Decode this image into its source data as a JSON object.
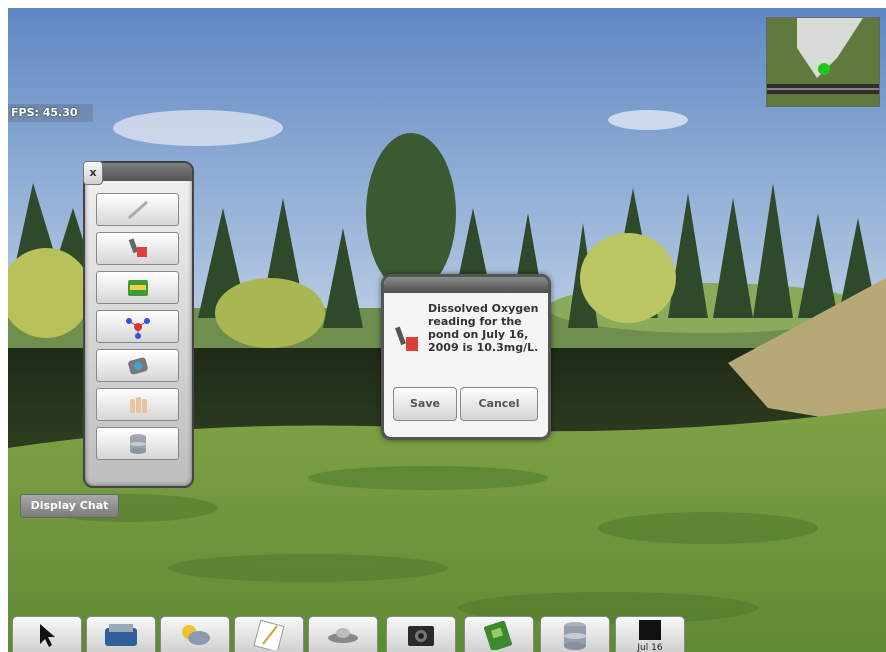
{
  "hud": {
    "fps": "FPS: 45.30"
  },
  "tool_panel": {
    "close_label": "x",
    "tools": [
      {
        "name": "pencil-icon"
      },
      {
        "name": "probe-icon"
      },
      {
        "name": "test-kit-icon"
      },
      {
        "name": "molecule-icon"
      },
      {
        "name": "camera-id-icon"
      },
      {
        "name": "specimen-icon"
      },
      {
        "name": "database-icon"
      }
    ]
  },
  "chat": {
    "button_label": "Display Chat"
  },
  "dialog": {
    "message": "Dissolved Oxygen reading for the pond on July 16, 2009 is 10.3mg/L.",
    "save_label": "Save",
    "cancel_label": "Cancel"
  },
  "taskbar": {
    "items": [
      {
        "name": "pointer-icon"
      },
      {
        "name": "toolbox-icon"
      },
      {
        "name": "weather-icon"
      },
      {
        "name": "notebook-icon"
      },
      {
        "name": "teleport-icon"
      },
      {
        "name": "camera-icon"
      },
      {
        "name": "field-guide-icon"
      },
      {
        "name": "database-icon"
      },
      {
        "name": "calendar-icon"
      }
    ],
    "date_label": "Jul 16"
  }
}
